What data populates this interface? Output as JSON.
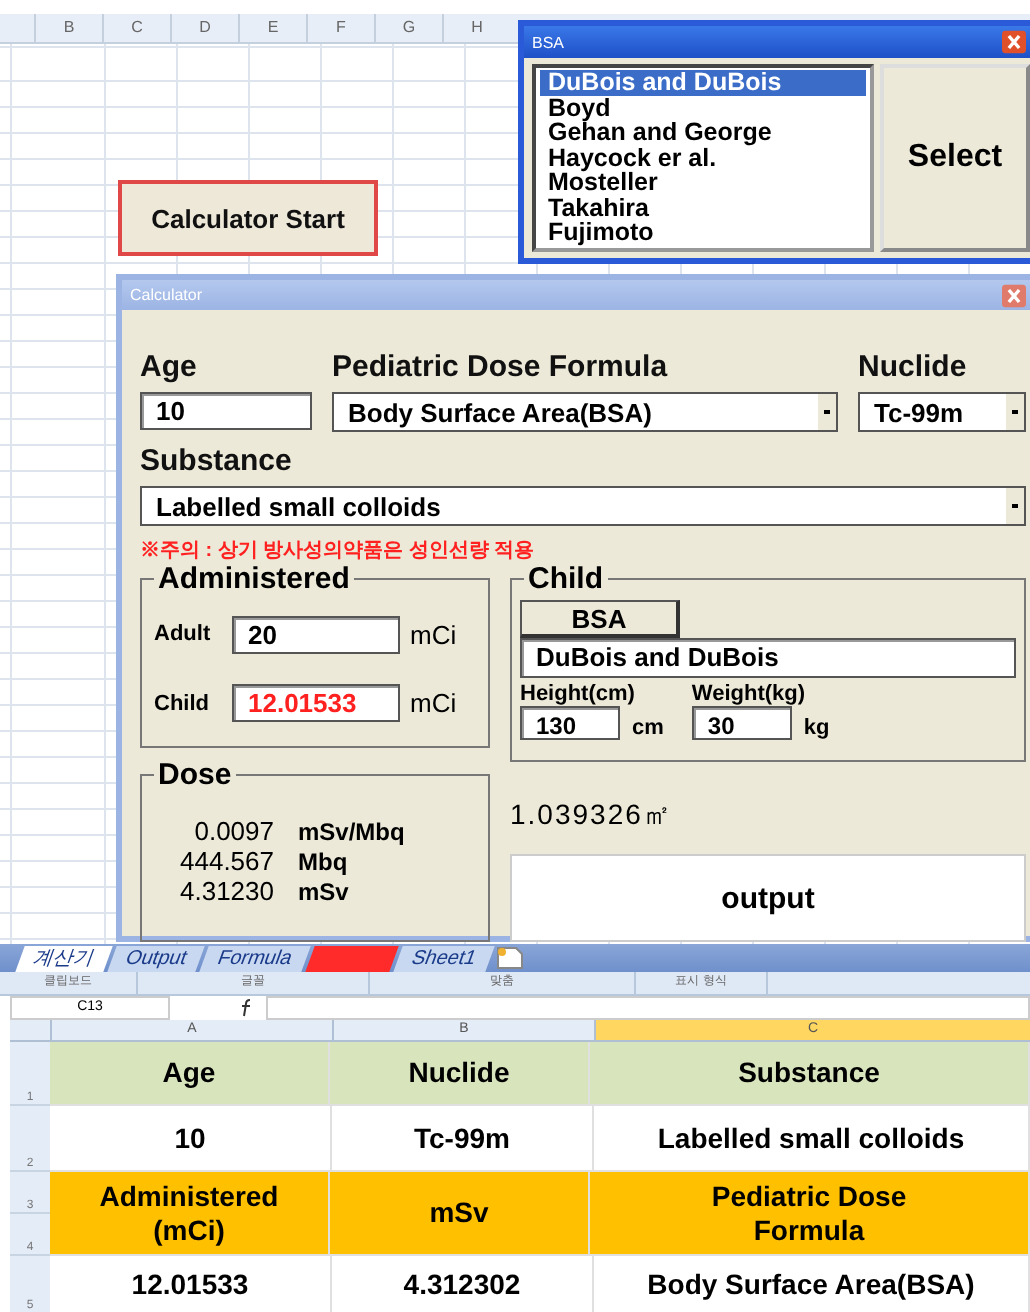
{
  "sheet_top": {
    "column_headers": [
      "B",
      "C",
      "D",
      "E",
      "F",
      "G",
      "H"
    ]
  },
  "start_button": "Calculator Start",
  "bsa_window": {
    "title": "BSA",
    "items": [
      {
        "label": "DuBois and DuBois",
        "selected": true
      },
      {
        "label": "Boyd",
        "selected": false
      },
      {
        "label": "Gehan and George",
        "selected": false
      },
      {
        "label": "Haycock er al.",
        "selected": false
      },
      {
        "label": "Mosteller",
        "selected": false
      },
      {
        "label": "Takahira",
        "selected": false
      },
      {
        "label": "Fujimoto",
        "selected": false
      }
    ],
    "select_button": "Select"
  },
  "calculator": {
    "title": "Calculator",
    "age": {
      "label": "Age",
      "value": "10"
    },
    "formula": {
      "label": "Pediatric Dose Formula",
      "value": "Body Surface Area(BSA)"
    },
    "nuclide": {
      "label": "Nuclide",
      "value": "Tc-99m"
    },
    "substance": {
      "label": "Substance",
      "value": "Labelled small colloids"
    },
    "warning": "※주의 : 상기 방사성의약품은 성인선량 적용",
    "administered": {
      "title": "Administered",
      "fields": [
        {
          "label": "Adult",
          "value": "20",
          "unit": "mCi",
          "highlight": false
        },
        {
          "label": "Child",
          "value": "12.01533",
          "unit": "mCi",
          "highlight": true
        }
      ]
    },
    "child": {
      "title": "Child",
      "method": "BSA",
      "formula_name": "DuBois and DuBois",
      "measures": [
        {
          "label": "Height(cm)",
          "value": "130",
          "unit": "cm"
        },
        {
          "label": "Weight(kg)",
          "value": "30",
          "unit": "kg"
        }
      ]
    },
    "dose": {
      "title": "Dose",
      "rows": [
        {
          "value": "0.0097",
          "unit": "mSv/Mbq"
        },
        {
          "value": "444.567",
          "unit": "Mbq"
        },
        {
          "value": "4.31230",
          "unit": "mSv"
        }
      ]
    },
    "bsa_result": "1.039326㎡",
    "output_button": "output"
  },
  "sheet_tabs": [
    {
      "label": "계산기",
      "selected": true
    },
    {
      "label": "Output",
      "selected": false
    },
    {
      "label": "Formula",
      "selected": false
    },
    {
      "selected": false,
      "color": "#ff2a2a"
    },
    {
      "label": "Sheet1",
      "selected": false
    }
  ],
  "ribbon_groups": [
    "클립보드",
    "글꼴",
    "맞춤",
    "표시 형식"
  ],
  "name_box": "C13",
  "table": {
    "columns": [
      {
        "label": "A",
        "selected": false
      },
      {
        "label": "B",
        "selected": false
      },
      {
        "label": "C",
        "selected": true
      }
    ],
    "row_numbers": [
      "1",
      "2",
      "3",
      "4",
      "5"
    ],
    "rows": [
      {
        "kind": "header",
        "color": "#d8e4bc",
        "cells": [
          "Age",
          "Nuclide",
          "Substance"
        ]
      },
      {
        "kind": "value",
        "cells": [
          "10",
          "Tc-99m",
          "Labelled small colloids"
        ]
      },
      {
        "kind": "header",
        "color": "#ffc000",
        "cells": [
          "Administered (mCi)",
          "mSv",
          "Pediatric Dose Formula"
        ]
      },
      {
        "kind": "value",
        "cells": [
          "12.01533",
          "4.312302",
          "Body Surface Area(BSA)"
        ]
      }
    ]
  }
}
